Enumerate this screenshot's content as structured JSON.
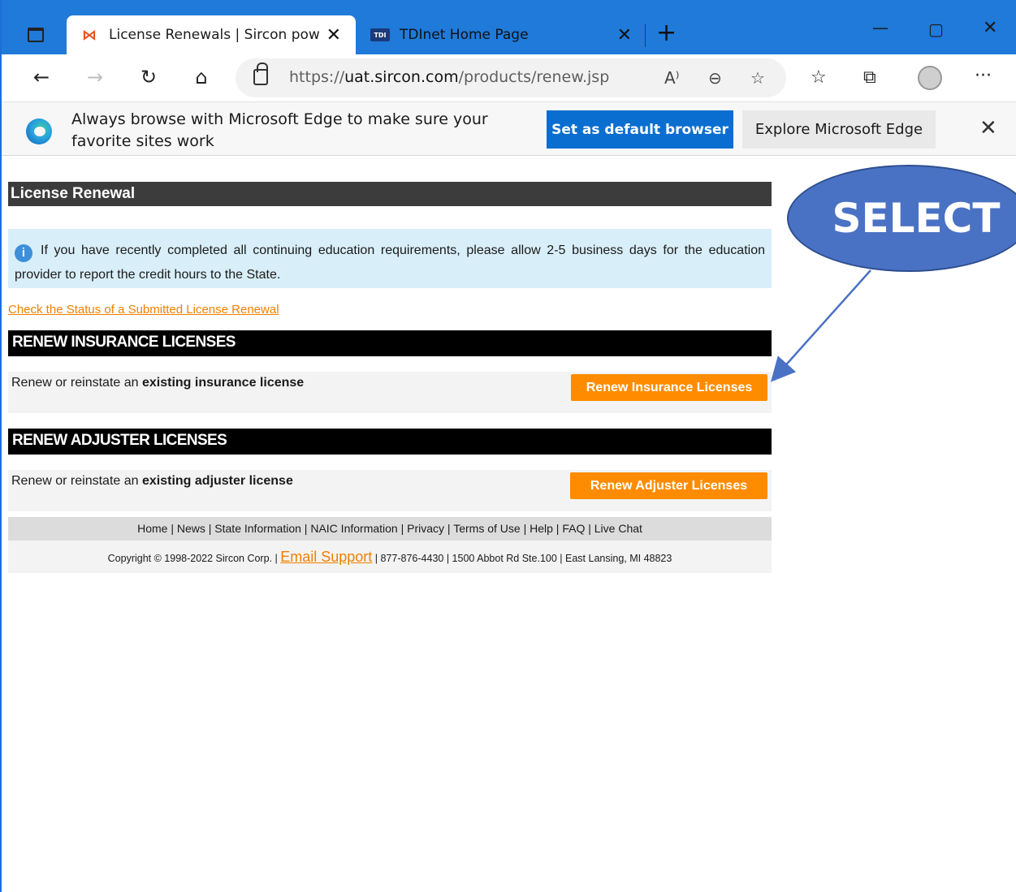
{
  "browser": {
    "tabs": [
      {
        "title": "License Renewals | Sircon powere",
        "favicon": "sircon-icon"
      },
      {
        "title": "TDInet Home Page",
        "favicon": "tdi-icon",
        "favicon_text": "TDI"
      }
    ],
    "url_prefix": "https://",
    "url_host": "uat.sircon.com",
    "url_path": "/products/renew.jsp"
  },
  "infobar": {
    "message": "Always browse with Microsoft Edge to make sure your favorite sites work",
    "default_button": "Set as default browser",
    "explore_button": "Explore Microsoft Edge"
  },
  "page": {
    "title": "License Renewal",
    "notice": "If you have recently completed all continuing education requirements, please allow 2-5 business days for the education provider to report the credit hours to the State.",
    "status_link": "Check the Status of a Submitted License Renewal",
    "insurance": {
      "header": "RENEW INSURANCE LICENSES",
      "desc_prefix": "Renew or reinstate an",
      "desc_bold": "existing insurance license",
      "button": "Renew Insurance Licenses"
    },
    "adjuster": {
      "header": "RENEW ADJUSTER LICENSES",
      "desc_prefix": "Renew or reinstate an",
      "desc_bold": "existing adjuster license",
      "button": "Renew Adjuster Licenses"
    },
    "footer_links": [
      "Home",
      "News",
      "State Information",
      "NAIC Information",
      "Privacy",
      "Terms of Use",
      "Help",
      "FAQ",
      "Live Chat"
    ],
    "copyright": "Copyright © 1998-2022 Sircon Corp. |",
    "email_support": "Email Support",
    "contact": "| 877-876-4430 | 1500 Abbot Rd Ste.100 | East Lansing, MI 48823"
  },
  "annotation": {
    "callout_text": "SELECT"
  },
  "colors": {
    "tabbar": "#1f7ad9",
    "primary_button": "#0a6ed1",
    "orange": "#ff8c00",
    "callout": "#4a72c4"
  }
}
